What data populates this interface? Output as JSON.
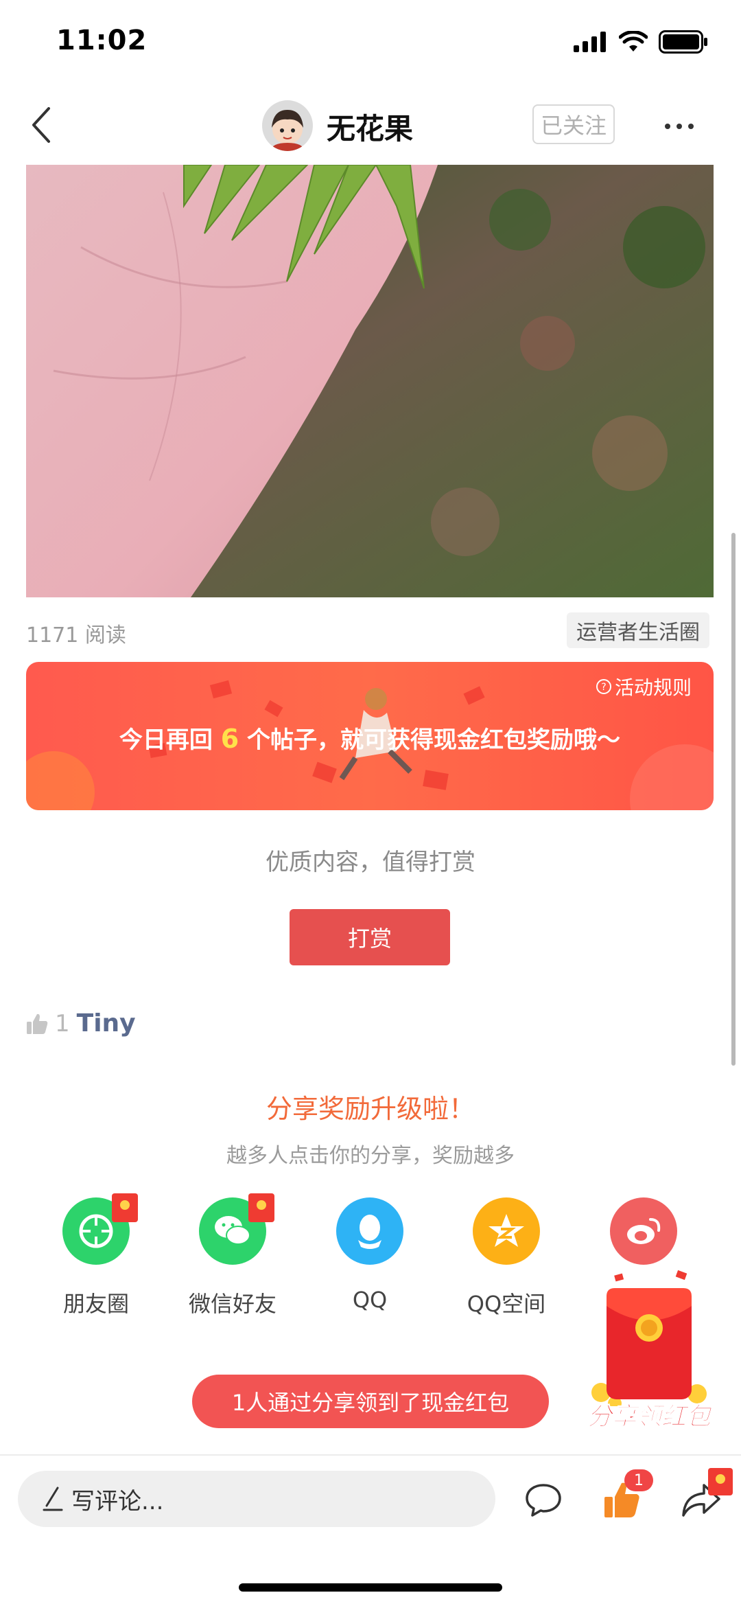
{
  "status_bar": {
    "time": "11:02"
  },
  "nav": {
    "title": "无花果",
    "follow_label": "已关注"
  },
  "post": {
    "read_count": "1171 阅读",
    "circle": "运营者生活圈"
  },
  "banner": {
    "rules": "活动规则",
    "text_before": "今日再回 ",
    "highlight": "6",
    "text_after": " 个帖子，就可获得现金红包奖励哦～"
  },
  "reward": {
    "tip": "优质内容，值得打赏",
    "button": "打赏"
  },
  "likes": {
    "count": "1",
    "user": "Tiny"
  },
  "share": {
    "title": "分享奖励升级啦！",
    "subtitle": "越多人点击你的分享，奖励越多",
    "items": [
      {
        "label": "朋友圈",
        "color": "#2dd36b",
        "icon": "moments-icon"
      },
      {
        "label": "微信好友",
        "color": "#2dd36b",
        "icon": "wechat-icon"
      },
      {
        "label": "QQ",
        "color": "#2eb3f5",
        "icon": "qq-icon"
      },
      {
        "label": "QQ空间",
        "color": "#fdb016",
        "icon": "qzone-icon"
      },
      {
        "label": "微博",
        "color": "#f06060",
        "icon": "weibo-icon"
      }
    ],
    "float_label": "分享领红包",
    "result": "1人通过分享领到了现金红包"
  },
  "bottom_bar": {
    "comment_placeholder": "写评论...",
    "like_badge": "1"
  },
  "colors": {
    "accent_red": "#e6504f",
    "banner_red": "#ff5a4e",
    "highlight_yellow": "#ffe14a",
    "link_blue": "#5a6a8e"
  }
}
